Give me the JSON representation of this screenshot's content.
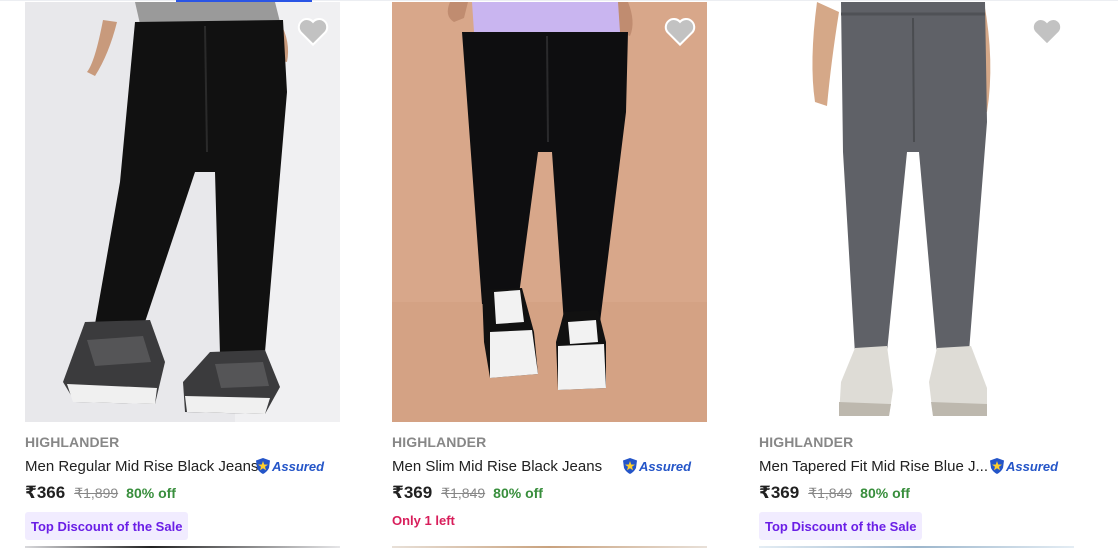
{
  "currency_symbol": "₹",
  "products": [
    {
      "brand": "HIGHLANDER",
      "title": "Men Regular Mid Rise Black Jeans",
      "price": "₹366",
      "mrp": "₹1,899",
      "discount": "80% off",
      "assured_label": "Assured",
      "badge": "Top Discount of the Sale",
      "stock_note": "",
      "image_bg": "#e9e9ec",
      "jeans_color": "#111111"
    },
    {
      "brand": "HIGHLANDER",
      "title": "Men Slim Mid Rise Black Jeans",
      "price": "₹369",
      "mrp": "₹1,849",
      "discount": "80% off",
      "assured_label": "Assured",
      "badge": "",
      "stock_note": "Only 1 left",
      "image_bg": "#d9a88a",
      "jeans_color": "#0e0e10"
    },
    {
      "brand": "HIGHLANDER",
      "title": "Men Tapered Fit Mid Rise Blue J...",
      "price": "₹369",
      "mrp": "₹1,849",
      "discount": "80% off",
      "assured_label": "Assured",
      "badge": "Top Discount of the Sale",
      "stock_note": "",
      "image_bg": "#ffffff",
      "jeans_color": "#5e6066"
    }
  ],
  "icons": {
    "wishlist": "heart-icon",
    "assured": "assured-shield-icon"
  },
  "colors": {
    "price_green": "#388e3c",
    "badge_purple": "#6a1ee6",
    "badge_bg": "#f1ecff",
    "stock_pink": "#d81e5b",
    "assured_blue": "#2455c8",
    "heart_gray": "#c2c2c2"
  }
}
